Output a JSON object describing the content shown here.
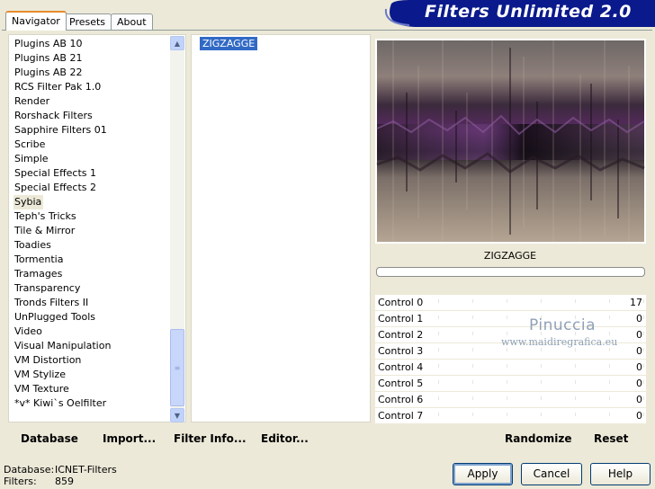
{
  "tabs": [
    "Navigator",
    "Presets",
    "About"
  ],
  "banner_title": "Filters Unlimited 2.0",
  "categories": [
    "Plugins AB 10",
    "Plugins AB 21",
    "Plugins AB 22",
    "RCS Filter Pak 1.0",
    "Render",
    "Rorshack Filters",
    "Sapphire Filters 01",
    "Scribe",
    "Simple",
    "Special Effects 1",
    "Special Effects 2",
    "Sybia",
    "Teph's Tricks",
    "Tile & Mirror",
    "Toadies",
    "Tormentia",
    "Tramages",
    "Transparency",
    "Tronds Filters II",
    "UnPlugged Tools",
    "Video",
    "Visual Manipulation",
    "VM Distortion",
    "VM Stylize",
    "VM Texture",
    "*v* Kiwi`s Oelfilter"
  ],
  "selected_category": "Sybia",
  "filters": [
    "ZIGZAGGE"
  ],
  "filter_name": "ZIGZAGGE",
  "controls": [
    {
      "label": "Control 0",
      "value": "17"
    },
    {
      "label": "Control 1",
      "value": "0"
    },
    {
      "label": "Control 2",
      "value": "0"
    },
    {
      "label": "Control 3",
      "value": "0"
    },
    {
      "label": "Control 4",
      "value": "0"
    },
    {
      "label": "Control 5",
      "value": "0"
    },
    {
      "label": "Control 6",
      "value": "0"
    },
    {
      "label": "Control 7",
      "value": "0"
    }
  ],
  "watermark": {
    "name": "Pinuccia",
    "url": "www.maidiregrafica.eu"
  },
  "link_buttons": {
    "database": "Database",
    "import": "Import...",
    "filter_info": "Filter Info...",
    "editor": "Editor...",
    "randomize": "Randomize",
    "reset": "Reset"
  },
  "info": {
    "database_label": "Database:",
    "database_value": "ICNET-Filters",
    "filters_label": "Filters:",
    "filters_value": "859"
  },
  "buttons": {
    "apply": "Apply",
    "cancel": "Cancel",
    "help": "Help"
  },
  "colors": {
    "banner": "#0a1a8c",
    "selection": "#316ac5",
    "tab_accent": "#e68b2c"
  },
  "icons": {
    "scroll_up": "chevron-up-icon",
    "scroll_down": "chevron-down-icon"
  }
}
